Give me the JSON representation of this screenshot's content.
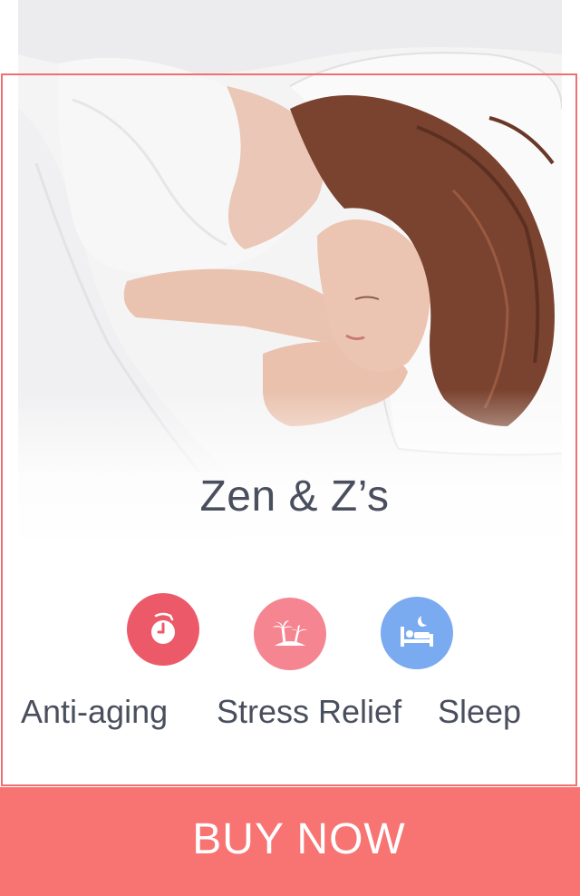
{
  "product": {
    "title": "Zen & Z’s",
    "image_alt": "woman-sleeping-photo"
  },
  "benefits": [
    {
      "label": "Anti-aging",
      "icon": "stopwatch-icon",
      "color": "#ec5a6a"
    },
    {
      "label": "Stress Relief",
      "icon": "palm-island-icon",
      "color": "#f58591"
    },
    {
      "label": "Sleep",
      "icon": "bed-moon-icon",
      "color": "#7aaaf0"
    }
  ],
  "cta": {
    "label": "BUY NOW",
    "color": "#f77472"
  },
  "colors": {
    "frame": "#f07070",
    "text": "#4a4f5e"
  }
}
